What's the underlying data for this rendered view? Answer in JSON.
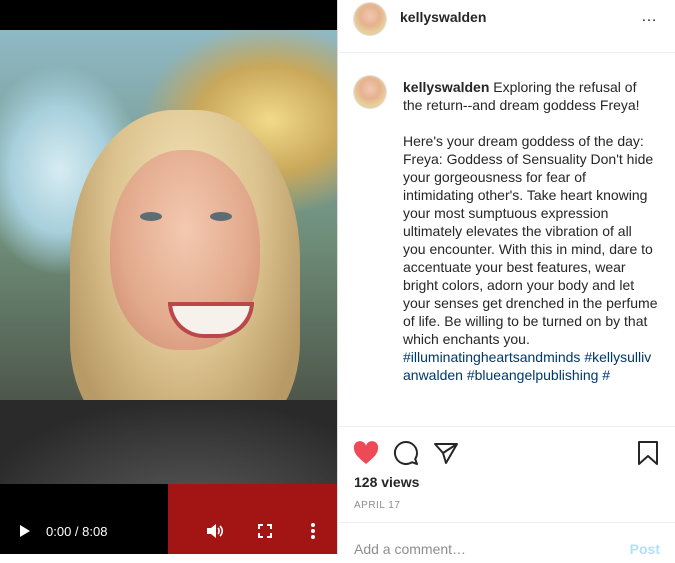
{
  "video": {
    "time_display": "0:00 / 8:08",
    "icons": [
      "play-icon",
      "volume-icon",
      "fullscreen-icon",
      "more-vertical-icon"
    ]
  },
  "post": {
    "username": "kellyswalden",
    "more_icon": "…",
    "caption": {
      "author": "kellyswalden",
      "intro": "Exploring the refusal of the return--and dream goddess Freya!",
      "body": "Here's your dream goddess of the day: Freya: Goddess of Sensuality Don't hide your gorgeousness for fear of intimidating other's. Take heart knowing your most sumptuous expression ultimately elevates the vibration of all you encounter. With this in mind, dare to accentuate your best features, wear bright colors, adorn your body and let your senses get drenched in the perfume of life. Be willing to be turned on by that which enchants you.",
      "hashtags": "#illuminatingheartsandminds #kellysullivanwalden #blueangelpublishing #"
    },
    "views": "128 views",
    "date": "APRIL 17",
    "comment_placeholder": "Add a comment…",
    "post_label": "Post",
    "colors": {
      "heart": "#ed4956",
      "hashtag": "#00376b",
      "muted": "#8e8e8e"
    }
  }
}
